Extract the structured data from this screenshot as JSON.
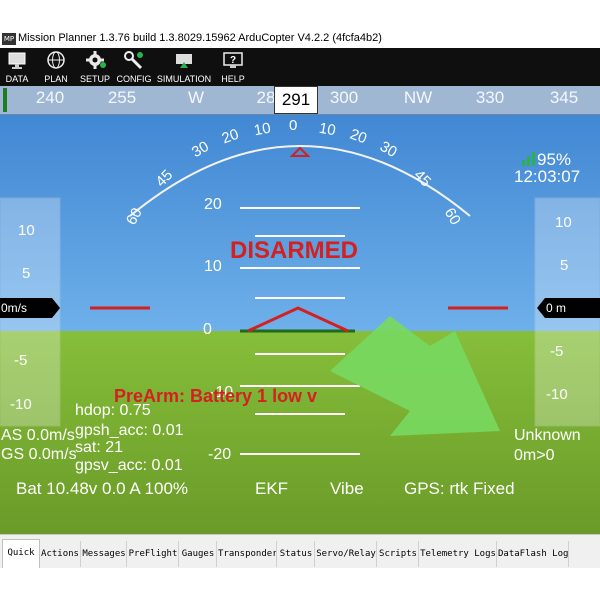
{
  "window": {
    "app_icon_text": "MP",
    "title": "Mission Planner 1.3.76 build 1.3.8029.15962 ArduCopter V4.2.2 (4fcfa4b2)"
  },
  "toolbar": {
    "items": [
      {
        "label": "DATA",
        "icon": "monitor-icon"
      },
      {
        "label": "PLAN",
        "icon": "globe-icon"
      },
      {
        "label": "SETUP",
        "icon": "setup-gear-icon"
      },
      {
        "label": "CONFIG",
        "icon": "wrench-icon"
      },
      {
        "label": "SIMULATION",
        "icon": "simulation-icon"
      },
      {
        "label": "HELP",
        "icon": "help-monitor-icon"
      }
    ]
  },
  "hud": {
    "heading_ticks": [
      "240",
      "255",
      "W",
      "28",
      "300",
      "NW",
      "330",
      "345"
    ],
    "heading_current": "291",
    "roll_scale_left": [
      "10",
      "20",
      "30",
      "45",
      "60"
    ],
    "roll_scale_center": "0",
    "roll_scale_right": [
      "10",
      "20",
      "30",
      "45",
      "60"
    ],
    "pitch_labels": [
      "20",
      "10",
      "0",
      "-10",
      "-20"
    ],
    "status_text": "DISARMED",
    "battery_signal": "95%",
    "clock": "12:03:07",
    "speed_tape": {
      "labels": [
        "10",
        "5",
        "-5",
        "-10"
      ],
      "current": "0m/s"
    },
    "alt_tape": {
      "labels": [
        "10",
        "5",
        "-5",
        "-10"
      ],
      "current": "0 m"
    },
    "prearm_text": "PreArm: Battery 1 low v",
    "telemetry": {
      "hdop": "hdop: 0.75",
      "gpsh_acc": "gpsh_acc: 0.01",
      "sat": "sat: 21",
      "gpsv_acc": "gpsv_acc: 0.01",
      "as": "AS 0.0m/s",
      "gs": "GS 0.0m/s"
    },
    "mode_text": "Unknown",
    "wp_text": "0m>0",
    "battery_text": "Bat 10.48v 0.0 A 100%",
    "ekf_text": "EKF",
    "vibe_text": "Vibe",
    "gps_text": "GPS: rtk Fixed",
    "colors": {
      "sky": "#4a8fd6",
      "ground": "#7cb030",
      "horizon": "#d42020",
      "accent_arrow": "#78d860"
    }
  },
  "tabs": [
    {
      "label": "Quick",
      "active": true
    },
    {
      "label": "Actions"
    },
    {
      "label": "Messages"
    },
    {
      "label": "PreFlight"
    },
    {
      "label": "Gauges"
    },
    {
      "label": "Transponder"
    },
    {
      "label": "Status"
    },
    {
      "label": "Servo/Relay"
    },
    {
      "label": "Scripts"
    },
    {
      "label": "Telemetry Logs"
    },
    {
      "label": "DataFlash Logs"
    }
  ]
}
